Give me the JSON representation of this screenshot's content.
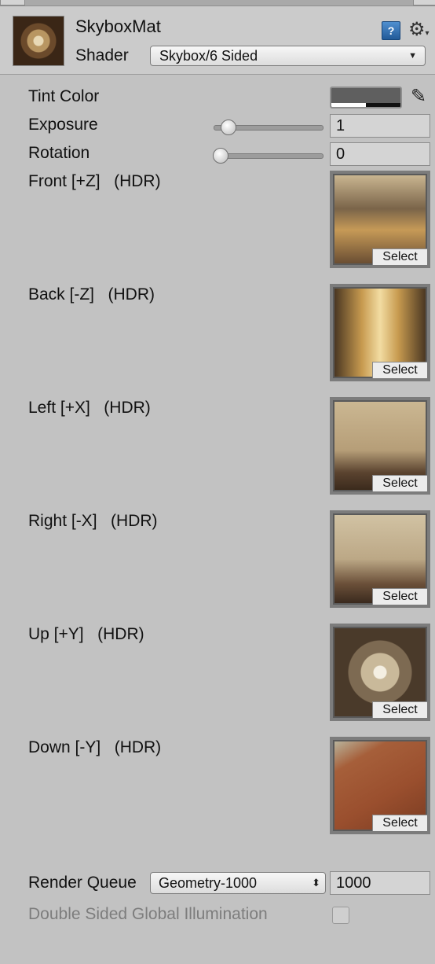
{
  "material": {
    "name": "SkyboxMat",
    "shader_label": "Shader",
    "shader_value": "Skybox/6 Sided"
  },
  "icons": {
    "help": "help-book-icon",
    "gear": "gear-dropdown-icon",
    "picker": "eyedropper-icon",
    "dropdown": "chevron-down-icon",
    "updown": "updown-arrows-icon"
  },
  "properties": {
    "tint": {
      "label": "Tint Color",
      "color": "#5f5f5f",
      "alpha": 0.5
    },
    "exposure": {
      "label": "Exposure",
      "value": "1",
      "slider_fraction": 0.12
    },
    "rotation": {
      "label": "Rotation",
      "value": "0",
      "slider_fraction": 0.05
    }
  },
  "textures": [
    {
      "label": "Front [+Z]   (HDR)",
      "select": "Select"
    },
    {
      "label": "Back [-Z]   (HDR)",
      "select": "Select"
    },
    {
      "label": "Left [+X]   (HDR)",
      "select": "Select"
    },
    {
      "label": "Right [-X]   (HDR)",
      "select": "Select"
    },
    {
      "label": "Up [+Y]   (HDR)",
      "select": "Select"
    },
    {
      "label": "Down [-Y]   (HDR)",
      "select": "Select"
    }
  ],
  "render_queue": {
    "label": "Render Queue",
    "dropdown": "Geometry-1000",
    "value": "1000"
  },
  "gi": {
    "label": "Double Sided Global Illumination",
    "checked": false
  }
}
